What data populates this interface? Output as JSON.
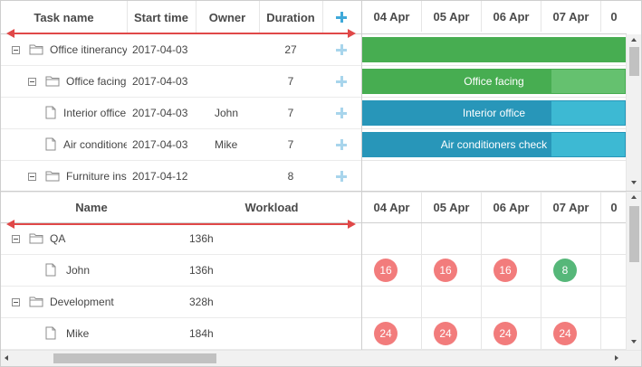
{
  "gantt": {
    "columns": {
      "task_name": "Task name",
      "start_time": "Start time",
      "owner": "Owner",
      "duration": "Duration"
    },
    "dates": [
      "04 Apr",
      "05 Apr",
      "06 Apr",
      "07 Apr",
      "0"
    ],
    "tasks": [
      {
        "name": "Office itinerancy",
        "start": "2017-04-03",
        "owner": "",
        "duration": "27",
        "level": 0,
        "type": "folder"
      },
      {
        "name": "Office facing",
        "start": "2017-04-03",
        "owner": "",
        "duration": "7",
        "level": 1,
        "type": "folder"
      },
      {
        "name": "Interior office",
        "start": "2017-04-03",
        "owner": "John",
        "duration": "7",
        "level": 2,
        "type": "file"
      },
      {
        "name": "Air conditioners check",
        "start": "2017-04-03",
        "owner": "Mike",
        "duration": "7",
        "level": 2,
        "type": "file"
      },
      {
        "name": "Furniture installation",
        "start": "2017-04-12",
        "owner": "",
        "duration": "8",
        "level": 1,
        "type": "folder"
      }
    ],
    "bars": [
      {
        "label": "",
        "progress": 1.0
      },
      {
        "label": "Office facing",
        "progress": 0.72
      },
      {
        "label": "Interior office",
        "progress": 0.72
      },
      {
        "label": "Air conditioners check",
        "progress": 0.72
      }
    ],
    "colors": {
      "project_bar": "#47ad51",
      "project_bar_light": "#65c16f",
      "task_bar": "#2896b9",
      "task_bar_light": "#3db9d3",
      "accent_plus": "#3fa9d9",
      "red_arrow": "#e04848"
    }
  },
  "resources": {
    "columns": {
      "name": "Name",
      "workload": "Workload"
    },
    "dates": [
      "04 Apr",
      "05 Apr",
      "06 Apr",
      "07 Apr",
      "0"
    ],
    "rows": [
      {
        "name": "QA",
        "workload": "136h",
        "level": 0,
        "type": "folder",
        "cells": []
      },
      {
        "name": "John",
        "workload": "136h",
        "level": 1,
        "type": "file",
        "cells": [
          {
            "value": "16",
            "status": "over"
          },
          {
            "value": "16",
            "status": "over"
          },
          {
            "value": "16",
            "status": "over"
          },
          {
            "value": "8",
            "status": "ok"
          }
        ]
      },
      {
        "name": "Development",
        "workload": "328h",
        "level": 0,
        "type": "folder",
        "cells": []
      },
      {
        "name": "Mike",
        "workload": "184h",
        "level": 1,
        "type": "file",
        "cells": [
          {
            "value": "24",
            "status": "over"
          },
          {
            "value": "24",
            "status": "over"
          },
          {
            "value": "24",
            "status": "over"
          },
          {
            "value": "24",
            "status": "over"
          }
        ]
      }
    ],
    "colors": {
      "over": "#f27c7c",
      "ok": "#56b779"
    }
  }
}
